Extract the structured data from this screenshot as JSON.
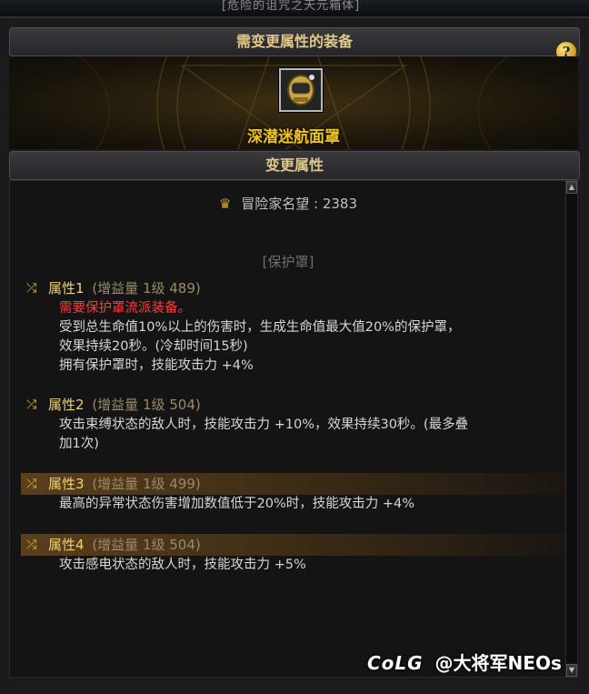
{
  "top_sliver": {
    "text": "[危险的诅咒之天元箱体]"
  },
  "header": {
    "title": "需变更属性的装备",
    "help_label": "?"
  },
  "item": {
    "name": "深潜迷航面罩",
    "icon": "mask-helmet-icon"
  },
  "section": {
    "title": "变更属性"
  },
  "reputation": {
    "label": "冒险家名望",
    "separator": ":",
    "value": "2383"
  },
  "category": "[保护罩]",
  "attributes": [
    {
      "name": "属性1",
      "meta": "(增益量 1级 489)",
      "highlighted": false,
      "lines": [
        "需要保护罩流派装备。",
        "受到总生命值10%以上的伤害时，生成生命值最大值20%的保护罩，",
        "效果持续20秒。(冷却时间15秒)",
        "拥有保护罩时，技能攻击力 +4%"
      ],
      "red_lines": [
        0
      ]
    },
    {
      "name": "属性2",
      "meta": "(增益量 1级 504)",
      "highlighted": false,
      "lines": [
        "攻击束缚状态的敌人时，技能攻击力 +10%，效果持续30秒。(最多叠",
        "加1次)"
      ]
    },
    {
      "name": "属性3",
      "meta": "(增益量 1级 499)",
      "highlighted": true,
      "lines": [
        "最高的异常状态伤害增加数值低于20%时，技能攻击力 +4%"
      ]
    },
    {
      "name": "属性4",
      "meta": "(增益量 1级 504)",
      "highlighted": true,
      "lines": [
        "攻击感电状态的敌人时，技能攻击力 +5%"
      ]
    }
  ],
  "watermark": {
    "brand": "CoLG",
    "handle": "@大将军NEOs"
  },
  "colors": {
    "gold": "#f0c419",
    "red": "#ff3c3c",
    "highlight": "#5a3f1c"
  }
}
